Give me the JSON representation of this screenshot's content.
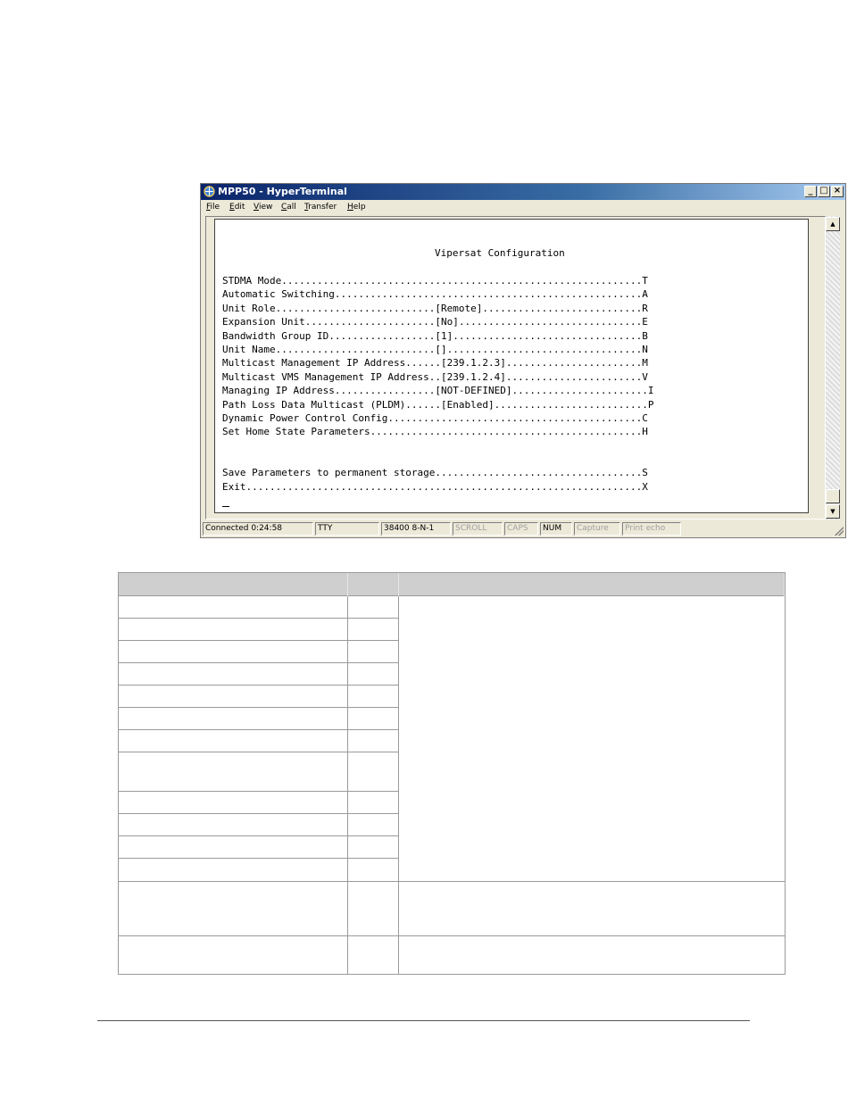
{
  "window": {
    "title": "MPP50 - HyperTerminal",
    "menu": [
      "File",
      "Edit",
      "View",
      "Call",
      "Transfer",
      "Help"
    ],
    "buttons": {
      "minimize": "_",
      "maximize": "□",
      "close": "×"
    }
  },
  "terminal": {
    "heading": "Vipersat Configuration",
    "lines": [
      "STDMA Mode.............................................................T",
      "Automatic Switching....................................................A",
      "Unit Role...........................[Remote]...........................R",
      "Expansion Unit......................[No]...............................E",
      "Bandwidth Group ID..................[1]................................B",
      "Unit Name...........................[].................................N",
      "Multicast Management IP Address......[239.1.2.3].......................M",
      "Multicast VMS Management IP Address..[239.1.2.4].......................V",
      "Managing IP Address.................[NOT-DEFINED].......................I",
      "Path Loss Data Multicast (PLDM)......[Enabled]..........................P",
      "Dynamic Power Control Config...........................................C",
      "Set Home State Parameters..............................................H",
      "",
      "",
      "Save Parameters to permanent storage...................................S",
      "Exit...................................................................X"
    ]
  },
  "statusbar": {
    "connected": "Connected 0:24:58",
    "emulation": "TTY",
    "settings": "38400 8-N-1",
    "scroll": "SCROLL",
    "caps": "CAPS",
    "num": "NUM",
    "capture": "Capture",
    "print_echo": "Print echo"
  }
}
